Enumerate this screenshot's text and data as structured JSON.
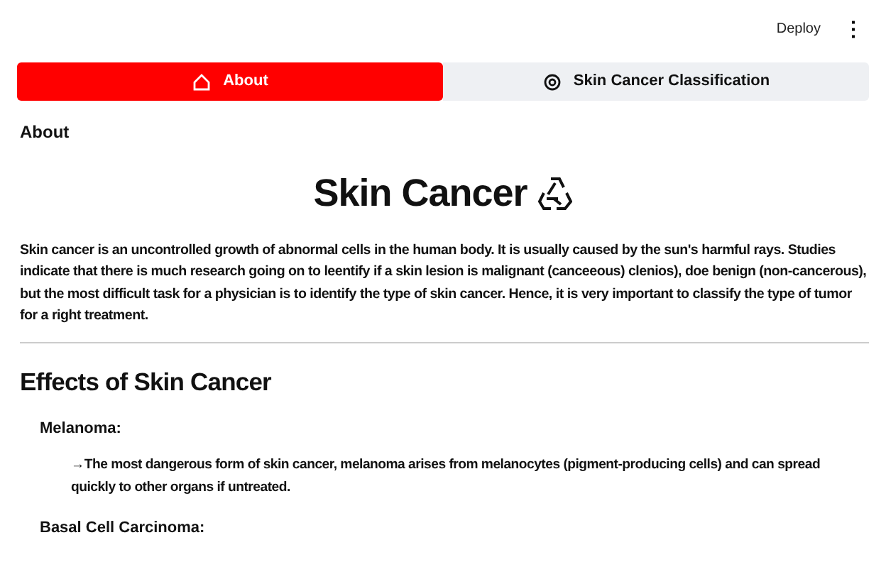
{
  "header": {
    "deploy": "Deploy",
    "menu": "⋮"
  },
  "tabs": [
    {
      "label": "About",
      "selected": true
    },
    {
      "label": "Skin Cancer Classification",
      "selected": false
    }
  ],
  "section_label": "About",
  "title": "Skin Cancer",
  "intro": "Skin cancer is an uncontrolled growth of abnormal cells in the human body. It is usually caused by the sun's harmful rays. Studies indicate that there is much research going on to leentify if a skin lesion is malignant (canceeous) clenios), doe benign (non-cancerous), but the most difficult task for a physician is to identify the type of skin cancer. Hence, it is very important to classify the type of tumor for a right treatment.",
  "effects_heading": "Effects of Skin Cancer",
  "effects": [
    {
      "name": "Melanoma:",
      "description": "→The most dangerous form of skin cancer, melanoma arises from melanocytes (pigment-producing cells) and can spread quickly to other organs if untreated."
    },
    {
      "name": "Basal Cell Carcinoma:"
    }
  ]
}
